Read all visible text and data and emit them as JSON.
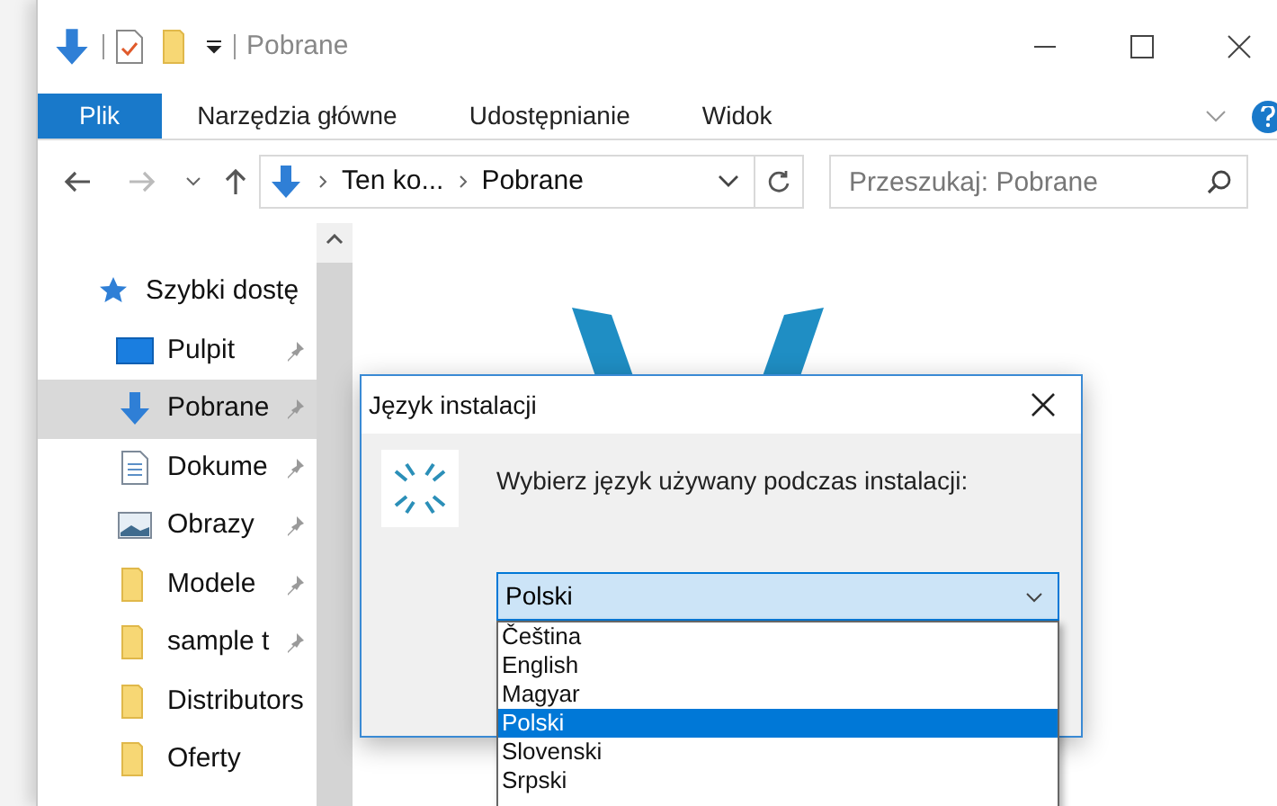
{
  "window": {
    "title": "Pobrane"
  },
  "ribbon_tabs": [
    {
      "label": "Plik",
      "selected": true
    },
    {
      "label": "Narzędzia główne",
      "selected": false
    },
    {
      "label": "Udostępnianie",
      "selected": false
    },
    {
      "label": "Widok",
      "selected": false
    }
  ],
  "address_bar": {
    "path": [
      "Ten ko...",
      "Pobrane"
    ]
  },
  "search": {
    "placeholder": "Przeszukaj: Pobrane"
  },
  "sidebar": {
    "items": [
      {
        "label": "Szybki dostę",
        "kind": "star",
        "pinned": false,
        "selected": false
      },
      {
        "label": "Pulpit",
        "kind": "desktop",
        "pinned": true,
        "selected": false
      },
      {
        "label": "Pobrane",
        "kind": "download",
        "pinned": true,
        "selected": true
      },
      {
        "label": "Dokume",
        "kind": "document",
        "pinned": true,
        "selected": false
      },
      {
        "label": "Obrazy",
        "kind": "picture",
        "pinned": true,
        "selected": false
      },
      {
        "label": "Modele",
        "kind": "folder",
        "pinned": true,
        "selected": false
      },
      {
        "label": "sample t",
        "kind": "folder",
        "pinned": true,
        "selected": false
      },
      {
        "label": "Distributors",
        "kind": "folder",
        "pinned": false,
        "selected": false
      },
      {
        "label": "Oferty",
        "kind": "folder",
        "pinned": false,
        "selected": false
      }
    ]
  },
  "dialog": {
    "title": "Język instalacji",
    "prompt": "Wybierz język używany podczas instalacji:",
    "select": {
      "value": "Polski"
    },
    "options": [
      {
        "label": "Čeština",
        "selected": false
      },
      {
        "label": "English",
        "selected": false
      },
      {
        "label": "Magyar",
        "selected": false
      },
      {
        "label": "Polski",
        "selected": true
      },
      {
        "label": "Slovenski",
        "selected": false
      },
      {
        "label": "Srpski",
        "selected": false
      }
    ]
  }
}
